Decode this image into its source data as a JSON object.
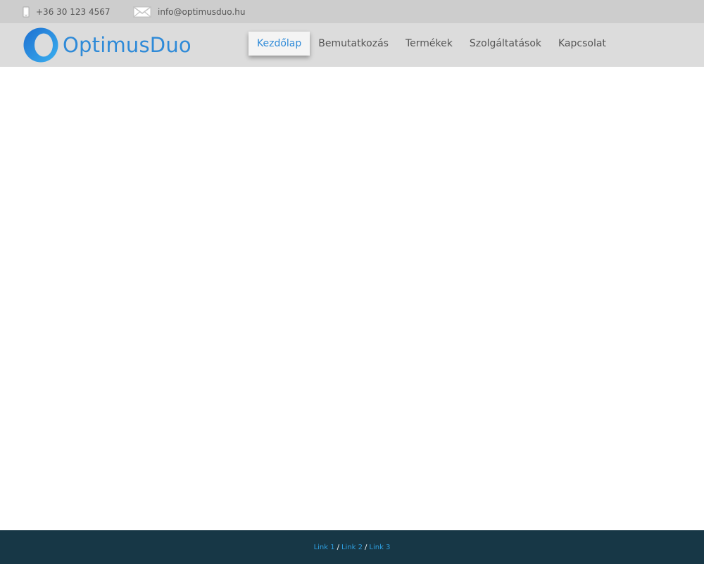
{
  "topbar": {
    "phone": {
      "icon": "mobile-phone-icon",
      "text": "+36 30 123 4567"
    },
    "email": {
      "icon": "envelope-icon",
      "text": "info@optimusduo.hu"
    }
  },
  "header": {
    "logo": {
      "icon": "ring-logo-icon",
      "text": "OptimusDuo"
    },
    "nav": [
      {
        "label": "Kezdőlap",
        "active": true
      },
      {
        "label": "Bemutatkozás",
        "active": false
      },
      {
        "label": "Termékek",
        "active": false
      },
      {
        "label": "Szolgáltatások",
        "active": false
      },
      {
        "label": "Kapcsolat",
        "active": false
      }
    ]
  },
  "footer": {
    "links": [
      "Link 1",
      "Link 2",
      "Link 3"
    ],
    "separator": "/"
  },
  "colors": {
    "brand_blue": "#2e8ad8",
    "topbar_bg": "#cdcdcd",
    "header_bg": "#dcdcdc",
    "footer_bg": "#173746",
    "footer_link": "#2e9fe0"
  }
}
